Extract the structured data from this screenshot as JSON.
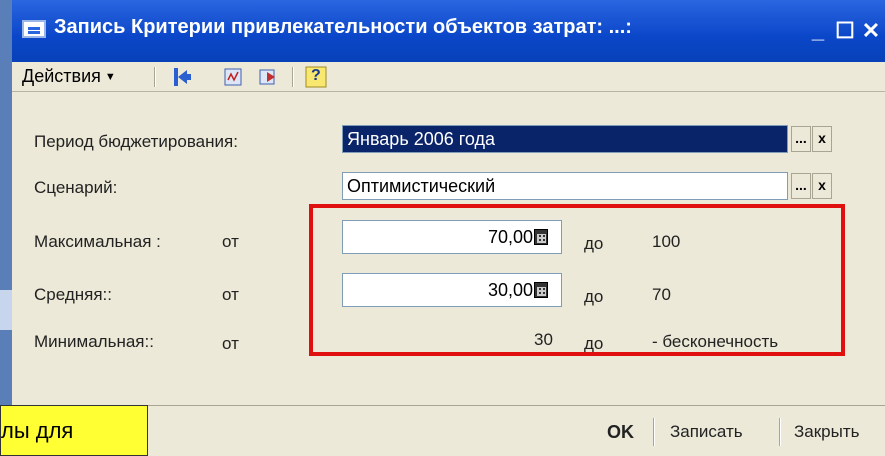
{
  "window": {
    "title": "Запись Критерии привлекательности объектов затрат: ...:",
    "controls": {
      "minimize": "_",
      "maximize": "☐",
      "close": "✕"
    }
  },
  "toolbar": {
    "actions_label": "Действия",
    "icons": [
      "back-arrow-icon",
      "document-icon",
      "refresh-icon",
      "help-icon"
    ],
    "help_glyph": "?"
  },
  "form": {
    "period": {
      "label": "Период бюджетирования:",
      "value": "Январь 2006 года"
    },
    "scenario": {
      "label": "Сценарий:",
      "value": "Оптимистический"
    },
    "max": {
      "label": "Максимальная :",
      "from": "от",
      "value": "70,00",
      "to": "до",
      "to_value": "100"
    },
    "mid": {
      "label": "Средняя::",
      "from": "от",
      "value": "30,00",
      "to": "до",
      "to_value": "70"
    },
    "min": {
      "label": "Минимальная::",
      "from": "от",
      "value": "30",
      "to": "до",
      "to_value": "- бесконечность"
    },
    "select_btn": "...",
    "clear_btn": "x"
  },
  "bottom": {
    "ok": "OK",
    "save": "Записать",
    "close": "Закрыть"
  },
  "note": {
    "text": "лы для"
  },
  "colors": {
    "highlight": "#e01010",
    "title_bar": "#0a46c8",
    "note_bg": "#ffff33"
  }
}
